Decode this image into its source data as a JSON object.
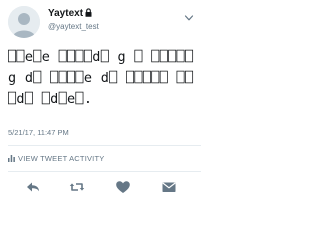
{
  "user": {
    "display_name": "Yaytext",
    "handle": "@yaytext_test",
    "protected": true
  },
  "tweet": {
    "text": "⎕⎕e⎕e ⎕⎕⎕⎕d⎕ g ⎕ ⎕⎕⎕⎕⎕ g d⎕ ⎕⎕⎕⎕e d⎕ ⎕⎕⎕⎕⎕ ⎕⎕⎕d⎕ ⎕d⎕e⎕.",
    "timestamp": "5/21/17, 11:47 PM"
  },
  "activity": {
    "label": "VIEW TWEET ACTIVITY"
  },
  "actions": [
    {
      "name": "reply-icon"
    },
    {
      "name": "retweet-icon"
    },
    {
      "name": "like-icon"
    },
    {
      "name": "direct-message-icon"
    }
  ],
  "colors": {
    "text": "#14171a",
    "secondary": "#657786",
    "divider": "#e6ecf0",
    "avatar_bg": "#e6ecf0",
    "avatar_fg": "#a9b7c2"
  }
}
